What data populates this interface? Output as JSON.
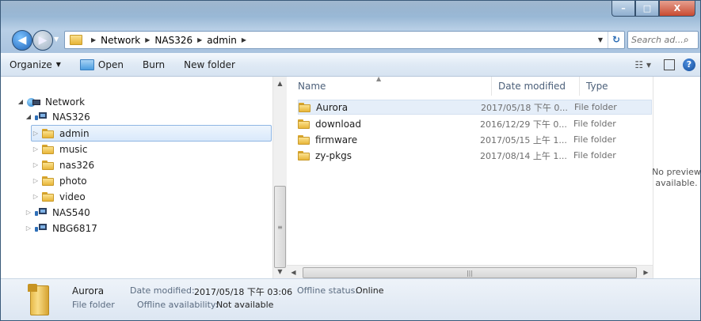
{
  "window": {
    "buttons": {
      "minimize": "–",
      "maximize": "□",
      "close": "X"
    }
  },
  "address": {
    "crumbs": [
      "Network",
      "NAS326",
      "admin"
    ],
    "search_placeholder": "Search ad..."
  },
  "toolbar": {
    "organize": "Organize",
    "open": "Open",
    "burn": "Burn",
    "new_folder": "New folder"
  },
  "tree": {
    "network": "Network",
    "nas326": "NAS326",
    "admin": "admin",
    "music": "music",
    "nas326_folder": "nas326",
    "photo": "photo",
    "video": "video",
    "nas540": "NAS540",
    "nbg6817": "NBG6817"
  },
  "columns": {
    "name": "Name",
    "date": "Date modified",
    "type": "Type"
  },
  "files": [
    {
      "name": "Aurora",
      "date": "2017/05/18 下午 0...",
      "type": "File folder"
    },
    {
      "name": "download",
      "date": "2016/12/29 下午 0...",
      "type": "File folder"
    },
    {
      "name": "firmware",
      "date": "2017/05/15 上午 1...",
      "type": "File folder"
    },
    {
      "name": "zy-pkgs",
      "date": "2017/08/14 上午 1...",
      "type": "File folder"
    }
  ],
  "preview": {
    "line1": "No preview",
    "line2": "available."
  },
  "details": {
    "name": "Aurora",
    "type": "File folder",
    "modified_label": "Date modified:",
    "modified": "2017/05/18 下午 03:06",
    "offline_avail_label": "Offline availability:",
    "offline_avail": "Not available",
    "status_label": "Offline status:",
    "status": "Online"
  }
}
